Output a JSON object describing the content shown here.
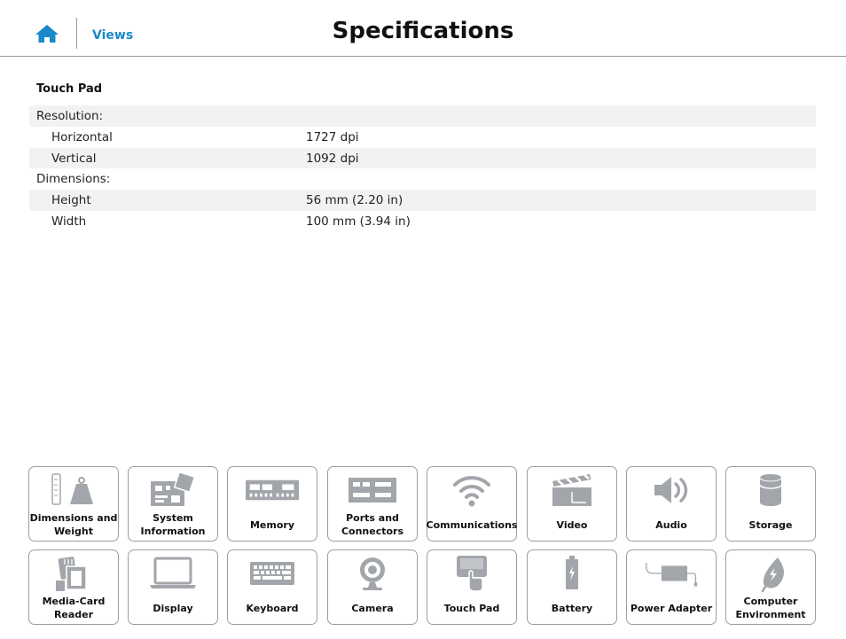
{
  "header": {
    "views_label": "Views",
    "title": "Specifications"
  },
  "section": {
    "title": "Touch Pad"
  },
  "specs": [
    {
      "label": "Resolution:",
      "value": ""
    },
    {
      "label": "Horizontal",
      "value": "1727 dpi"
    },
    {
      "label": "Vertical",
      "value": "1092 dpi"
    },
    {
      "label": "Dimensions:",
      "value": ""
    },
    {
      "label": "Height",
      "value": "56 mm (2.20 in)"
    },
    {
      "label": "Width",
      "value": "100 mm (3.94 in)"
    }
  ],
  "tiles": [
    {
      "label": "Dimensions and Weight",
      "icon": "weight-icon"
    },
    {
      "label": "System Information",
      "icon": "system-board-icon"
    },
    {
      "label": "Memory",
      "icon": "memory-icon"
    },
    {
      "label": "Ports and Connectors",
      "icon": "ports-icon"
    },
    {
      "label": "Communications",
      "icon": "wifi-icon"
    },
    {
      "label": "Video",
      "icon": "clapperboard-icon"
    },
    {
      "label": "Audio",
      "icon": "speaker-icon"
    },
    {
      "label": "Storage",
      "icon": "storage-icon"
    },
    {
      "label": "Media-Card Reader",
      "icon": "media-card-icon"
    },
    {
      "label": "Display",
      "icon": "laptop-icon"
    },
    {
      "label": "Keyboard",
      "icon": "keyboard-icon"
    },
    {
      "label": "Camera",
      "icon": "webcam-icon"
    },
    {
      "label": "Touch Pad",
      "icon": "touchpad-icon"
    },
    {
      "label": "Battery",
      "icon": "battery-icon"
    },
    {
      "label": "Power Adapter",
      "icon": "power-adapter-icon"
    },
    {
      "label": "Computer Environment",
      "icon": "leaf-icon"
    }
  ],
  "colors": {
    "accent": "#1a8ac6",
    "icon_gray": "#a2a6ab",
    "row_shade": "#f2f2f2"
  }
}
